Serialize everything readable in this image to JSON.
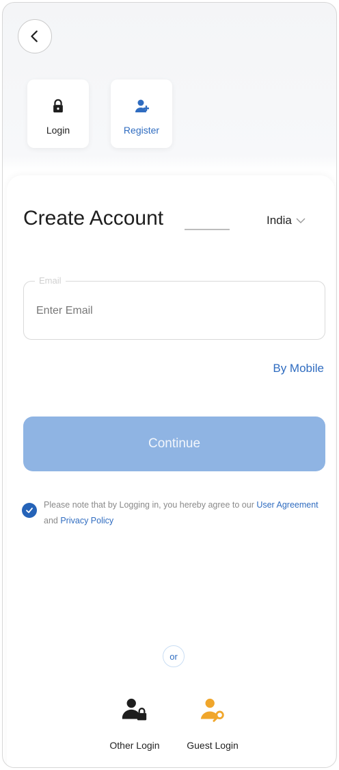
{
  "nav": {
    "back_icon": "chevron-left-icon"
  },
  "modes": [
    {
      "label": "Login",
      "icon": "lock-icon",
      "active": false
    },
    {
      "label": "Register",
      "icon": "register-user-icon",
      "active": true
    }
  ],
  "form": {
    "title": "Create Account",
    "country": "India",
    "email_label": "Email",
    "email_placeholder": "Enter Email",
    "email_value": "",
    "alt_method_link": "By Mobile",
    "continue_label": "Continue",
    "agreement": {
      "checked": true,
      "prefix": "Please note that by Logging in, you hereby agree to our ",
      "user_agreement": "User Agreement",
      "middle": " and ",
      "privacy_policy": "Privacy Policy"
    }
  },
  "separator": "or",
  "alt_logins": [
    {
      "label": "Other Login",
      "icon": "other-login-user-lock-icon"
    },
    {
      "label": "Guest Login",
      "icon": "guest-login-user-key-icon"
    }
  ],
  "colors": {
    "accent": "#2f6cc0",
    "button_disabled": "#8fb4e3",
    "checkbox": "#2563b8",
    "guest_icon": "#f0a62b"
  }
}
